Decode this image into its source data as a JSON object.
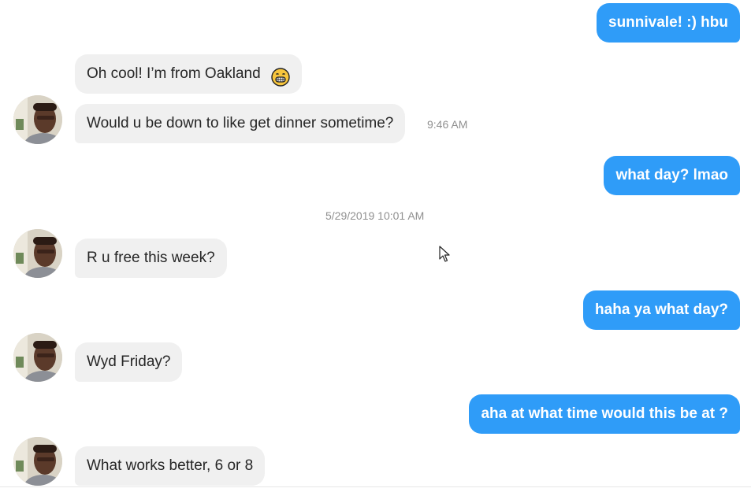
{
  "messages": {
    "m1": {
      "text": "sunnivale! :) hbu"
    },
    "m2": {
      "text": "Oh cool! I’m from Oakland"
    },
    "m3": {
      "text": "Would u be down to like get dinner sometime?",
      "time": "9:46 AM"
    },
    "m4": {
      "text": "what day? lmao"
    },
    "m5": {
      "text": "R u free this week?"
    },
    "m6": {
      "text": "haha ya what day?"
    },
    "m7": {
      "text": "Wyd Friday?"
    },
    "m8": {
      "text": "aha at what time would this be at  ?"
    },
    "m9": {
      "text": "What works better, 6 or 8"
    }
  },
  "date_separator": "5/29/2019 10:01 AM",
  "icons": {
    "emoji": "grinning-face-icon",
    "cursor": "mouse-pointer-icon",
    "avatar": "user-avatar"
  },
  "colors": {
    "outgoing_bubble": "#2f9cf8",
    "incoming_bubble": "#f0f0f0",
    "timestamp_text": "#8f8f8f",
    "emoji": "#f7c53d"
  }
}
